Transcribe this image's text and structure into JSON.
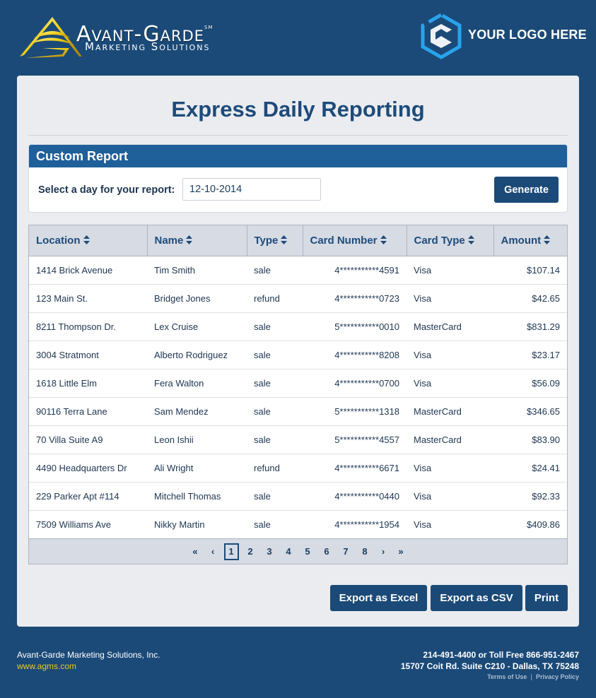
{
  "header": {
    "brand_name": "Avant-Garde",
    "brand_mark": "SM",
    "brand_tagline": "Marketing Solutions",
    "partner_logo_text": "YOUR LOGO HERE"
  },
  "page": {
    "title": "Express Daily Reporting"
  },
  "custom_report": {
    "heading": "Custom Report",
    "date_label": "Select a day for your report:",
    "date_value": "12-10-2014",
    "generate_label": "Generate"
  },
  "table": {
    "columns": [
      "Location",
      "Name",
      "Type",
      "Card Number",
      "Card Type",
      "Amount"
    ],
    "rows": [
      {
        "location": "1414 Brick Avenue",
        "name": "Tim Smith",
        "type": "sale",
        "card_number": "4***********4591",
        "card_type": "Visa",
        "amount": "$107.14"
      },
      {
        "location": "123 Main St.",
        "name": "Bridget Jones",
        "type": "refund",
        "card_number": "4***********0723",
        "card_type": "Visa",
        "amount": "$42.65"
      },
      {
        "location": "8211 Thompson Dr.",
        "name": "Lex Cruise",
        "type": "sale",
        "card_number": "5***********0010",
        "card_type": "MasterCard",
        "amount": "$831.29"
      },
      {
        "location": "3004 Stratmont",
        "name": "Alberto Rodriguez",
        "type": "sale",
        "card_number": "4***********8208",
        "card_type": "Visa",
        "amount": "$23.17"
      },
      {
        "location": "1618 Little Elm",
        "name": "Fera Walton",
        "type": "sale",
        "card_number": "4***********0700",
        "card_type": "Visa",
        "amount": "$56.09"
      },
      {
        "location": "90116 Terra Lane",
        "name": "Sam Mendez",
        "type": "sale",
        "card_number": "5***********1318",
        "card_type": "MasterCard",
        "amount": "$346.65"
      },
      {
        "location": "70 Villa Suite A9",
        "name": "Leon Ishii",
        "type": "sale",
        "card_number": "5***********4557",
        "card_type": "MasterCard",
        "amount": "$83.90"
      },
      {
        "location": "4490 Headquarters Dr",
        "name": "Ali Wright",
        "type": "refund",
        "card_number": "4***********6671",
        "card_type": "Visa",
        "amount": "$24.41"
      },
      {
        "location": "229 Parker Apt #114",
        "name": "Mitchell Thomas",
        "type": "sale",
        "card_number": "4***********0440",
        "card_type": "Visa",
        "amount": "$92.33"
      },
      {
        "location": "7509 Williams Ave",
        "name": "Nikky Martin",
        "type": "sale",
        "card_number": "4***********1954",
        "card_type": "Visa",
        "amount": "$409.86"
      }
    ]
  },
  "pagination": {
    "first": "«",
    "prev": "‹",
    "pages": [
      "1",
      "2",
      "3",
      "4",
      "5",
      "6",
      "7",
      "8"
    ],
    "current": "1",
    "next": "›",
    "last": "»"
  },
  "actions": {
    "export_excel": "Export as Excel",
    "export_csv": "Export as CSV",
    "print": "Print"
  },
  "footer": {
    "company": "Avant-Garde Marketing Solutions, Inc.",
    "website": "www.agms.com",
    "phone": "214-491-4400 or Toll Free 866-951-2467",
    "address": "15707 Coit Rd. Suite C210 - Dallas, TX 75248",
    "terms": "Terms of Use",
    "privacy": "Privacy Policy",
    "separator": "|"
  },
  "colors": {
    "background": "#1b4a78",
    "card": "#ebecf0",
    "panel_header": "#1f5f9a",
    "button": "#1b4a78",
    "accent_yellow": "#f0c81e",
    "logo_blue": "#29a3ec"
  }
}
